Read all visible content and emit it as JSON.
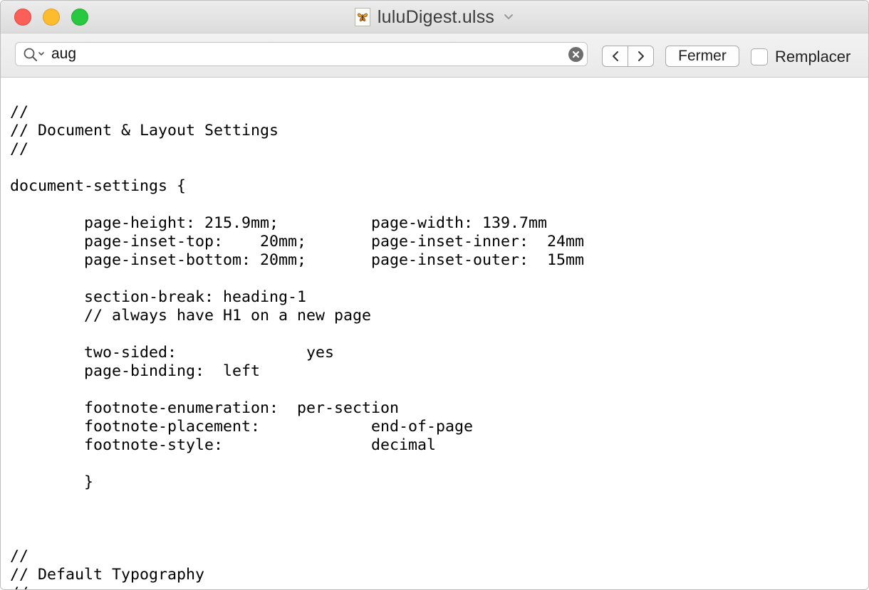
{
  "window": {
    "title": "luluDigest.ulss",
    "title_icon": "butterfly-document-icon"
  },
  "find_bar": {
    "search_value": "aug",
    "prev_symbol": "<",
    "next_symbol": ">",
    "close_label": "Fermer",
    "replace_label": "Remplacer",
    "replace_checked": false
  },
  "editor": {
    "lines": [
      "",
      "//",
      "// Document & Layout Settings",
      "//",
      "",
      "document-settings {",
      "",
      "        page-height: 215.9mm;          page-width: 139.7mm",
      "        page-inset-top:    20mm;       page-inset-inner:  24mm",
      "        page-inset-bottom: 20mm;       page-inset-outer:  15mm",
      "",
      "        section-break: heading-1",
      "        // always have H1 on a new page",
      "",
      "        two-sided:              yes",
      "        page-binding:  left",
      "",
      "        footnote-enumeration:  per-section",
      "        footnote-placement:            end-of-page",
      "        footnote-style:                decimal",
      "",
      "        }",
      "",
      "",
      "",
      "//",
      "// Default Typography",
      "//"
    ]
  },
  "colors": {
    "close": "#fc5f57",
    "minimize": "#fdbc2e",
    "zoom": "#28c840"
  }
}
